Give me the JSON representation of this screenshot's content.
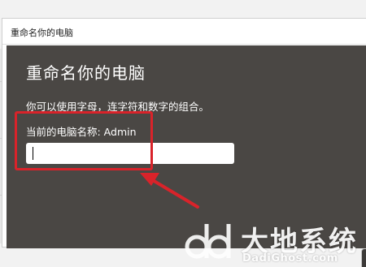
{
  "dialog": {
    "window_title": "重命名你的电脑",
    "heading": "重命名你的电脑",
    "description": "你可以使用字母，连字符和数字的组合。",
    "current_name": "当前的电脑名称: Admin",
    "name_input": {
      "value": "",
      "placeholder": ""
    }
  },
  "annotation": {
    "box_color": "#d9232a",
    "arrow_color": "#d9232a"
  },
  "watermark": {
    "text_cn": "大地系统",
    "text_en": "DadiGhost.com",
    "logo_icon": "dadi-logo-icon"
  },
  "colors": {
    "dialog_bg": "#4a4744",
    "title_bg": "#ffffff"
  }
}
